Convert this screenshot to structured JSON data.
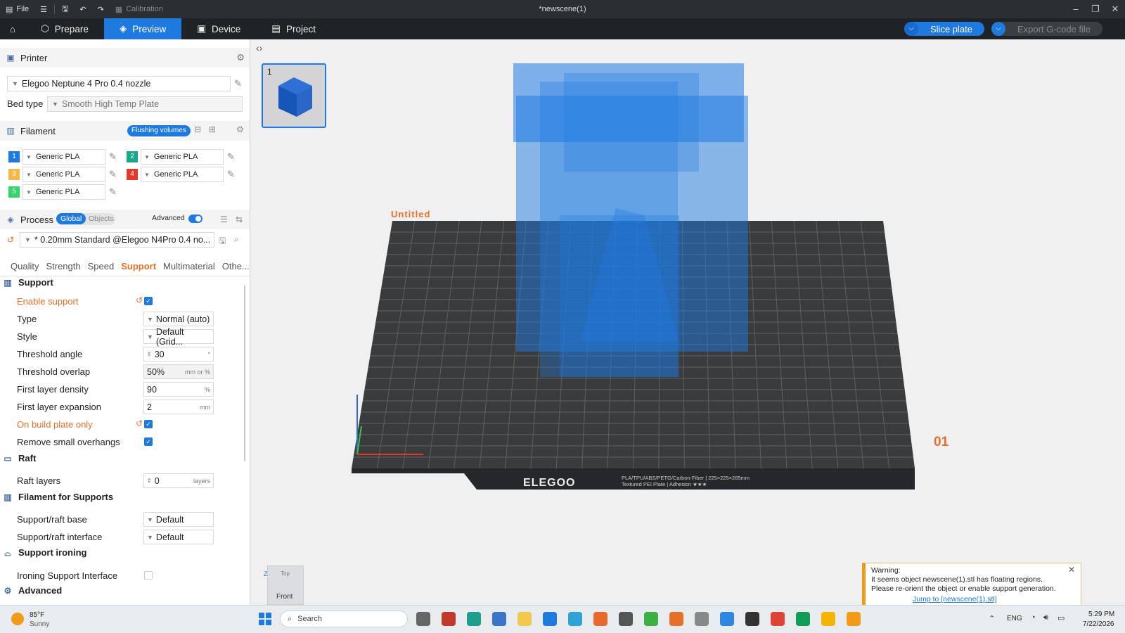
{
  "window": {
    "title": "*newscene(1)",
    "file_label": "File",
    "calibration_label": "Calibration"
  },
  "tabs": {
    "prepare": "Prepare",
    "preview": "Preview",
    "device": "Device",
    "project": "Project"
  },
  "actions": {
    "slice": "Slice plate",
    "export": "Export G-code file"
  },
  "printer": {
    "section_label": "Printer",
    "name": "Elegoo Neptune 4 Pro 0.4 nozzle",
    "bed_type_label": "Bed type",
    "bed_type": "Smooth High Temp Plate"
  },
  "filament": {
    "section_label": "Filament",
    "flushing_label": "Flushing volumes",
    "items": [
      {
        "num": "1",
        "name": "Generic PLA",
        "color": "#1f7ae0"
      },
      {
        "num": "2",
        "name": "Generic PLA",
        "color": "#19a98a"
      },
      {
        "num": "3",
        "name": "Generic PLA",
        "color": "#f3b94a"
      },
      {
        "num": "4",
        "name": "Generic PLA",
        "color": "#e23a2a"
      },
      {
        "num": "5",
        "name": "Generic PLA",
        "color": "#33d66a"
      }
    ]
  },
  "process": {
    "section_label": "Process",
    "global_label": "Global",
    "objects_label": "Objects",
    "advanced_label": "Advanced",
    "preset": "* 0.20mm Standard @Elegoo N4Pro 0.4 no...",
    "subtabs": [
      "Quality",
      "Strength",
      "Speed",
      "Support",
      "Multimaterial",
      "Othe..."
    ],
    "active_subtab": "Support"
  },
  "support": {
    "group_label": "Support",
    "enable_label": "Enable support",
    "type_label": "Type",
    "type_value": "Normal (auto)",
    "style_label": "Style",
    "style_value": "Default (Grid...",
    "threshold_angle_label": "Threshold angle",
    "threshold_angle_value": "30",
    "threshold_angle_unit": "°",
    "threshold_overlap_label": "Threshold overlap",
    "threshold_overlap_value": "50%",
    "threshold_overlap_unit": "mm or %",
    "first_layer_density_label": "First layer density",
    "first_layer_density_value": "90",
    "first_layer_density_unit": "%",
    "first_layer_expansion_label": "First layer expansion",
    "first_layer_expansion_value": "2",
    "first_layer_expansion_unit": "mm",
    "build_plate_only_label": "On build plate only",
    "remove_small_label": "Remove small overhangs"
  },
  "raft": {
    "group_label": "Raft",
    "layers_label": "Raft layers",
    "layers_value": "0",
    "layers_unit": "layers"
  },
  "filament_supports": {
    "group_label": "Filament for Supports",
    "base_label": "Support/raft base",
    "base_value": "Default",
    "interface_label": "Support/raft interface",
    "interface_value": "Default"
  },
  "ironing": {
    "group_label": "Support ironing",
    "interface_label": "Ironing Support Interface"
  },
  "advanced_group_label": "Advanced",
  "viewport": {
    "plate_number": "1",
    "plate_name": "Untitled",
    "plate_index": "01",
    "brand": "ELEGOO",
    "plate_info": "PLA/TPU/ABS/PETG/Carbon-Fiber | 225×225×265mm",
    "plate_info2": "Textured PEI Plate | Adhesion ★★★",
    "view_top": "Top",
    "view_front": "Front",
    "axis_z": "Z"
  },
  "warning": {
    "title": "Warning:",
    "text": "It seems object newscene(1).stl has floating regions. Please re-orient the object or enable support generation.",
    "link": "Jump to [newscene(1).stl]"
  },
  "taskbar": {
    "temp": "85°F",
    "weather": "Sunny",
    "search": "Search",
    "lang": "ENG",
    "time": "5:29 PM",
    "date": "7/22/2026"
  }
}
